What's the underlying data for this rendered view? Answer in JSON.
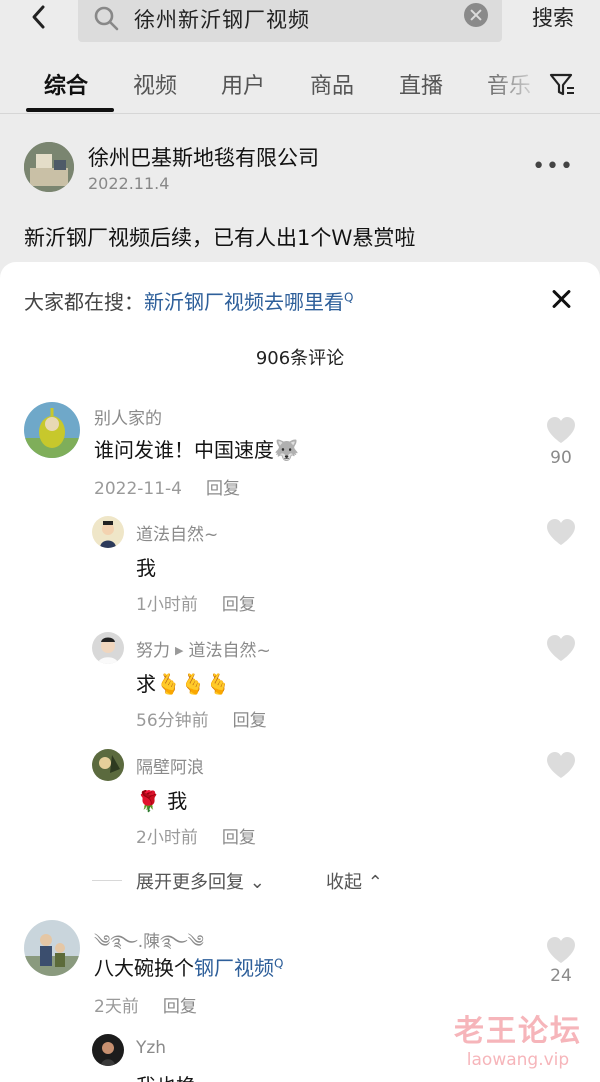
{
  "search": {
    "query": "徐州新沂钢厂视频",
    "button_label": "搜索"
  },
  "tabs": [
    {
      "label": "综合",
      "active": true
    },
    {
      "label": "视频"
    },
    {
      "label": "用户"
    },
    {
      "label": "商品"
    },
    {
      "label": "直播"
    },
    {
      "label": "音乐"
    }
  ],
  "post": {
    "author": "徐州巴基斯地毯有限公司",
    "date": "2022.11.4",
    "text": "新沂钢厂视频后续，已有人出1个Ｗ悬赏啦"
  },
  "sheet": {
    "hot_prefix": "大家都在搜：",
    "hot_link": "新沂钢厂视频去哪里看",
    "comment_count": "906条评论"
  },
  "comments": [
    {
      "user": "别人家的",
      "text": "谁问发谁！中国速度",
      "emoji": "🐺",
      "date": "2022-11-4",
      "reply_label": "回复",
      "likes": "90"
    },
    {
      "user": "道法自然~",
      "text": "我",
      "date": "1小时前",
      "reply_label": "回复"
    },
    {
      "user": "努力",
      "reply_to": "道法自然~",
      "text": "求",
      "emoji": "🫰🫰🫰",
      "date": "56分钟前",
      "reply_label": "回复"
    },
    {
      "user": "隔壁阿浪",
      "emoji": "🌹",
      "text": "我",
      "date": "2小时前",
      "reply_label": "回复"
    },
    {
      "user": "༄࿐.陳࿐༄",
      "text": "八大碗换个",
      "link": "钢厂视频",
      "date": "2天前",
      "reply_label": "回复",
      "likes": "24"
    },
    {
      "user": "Yzh",
      "text": "我也换"
    }
  ],
  "expand": {
    "more_label": "展开更多回复",
    "collapse_label": "收起"
  },
  "watermark": {
    "cn": "老王论坛",
    "en": "laowang.vip"
  },
  "colors": {
    "link_blue": "#2e5f9a",
    "sheet_bg": "#ffffff",
    "page_bg": "#ececec"
  }
}
